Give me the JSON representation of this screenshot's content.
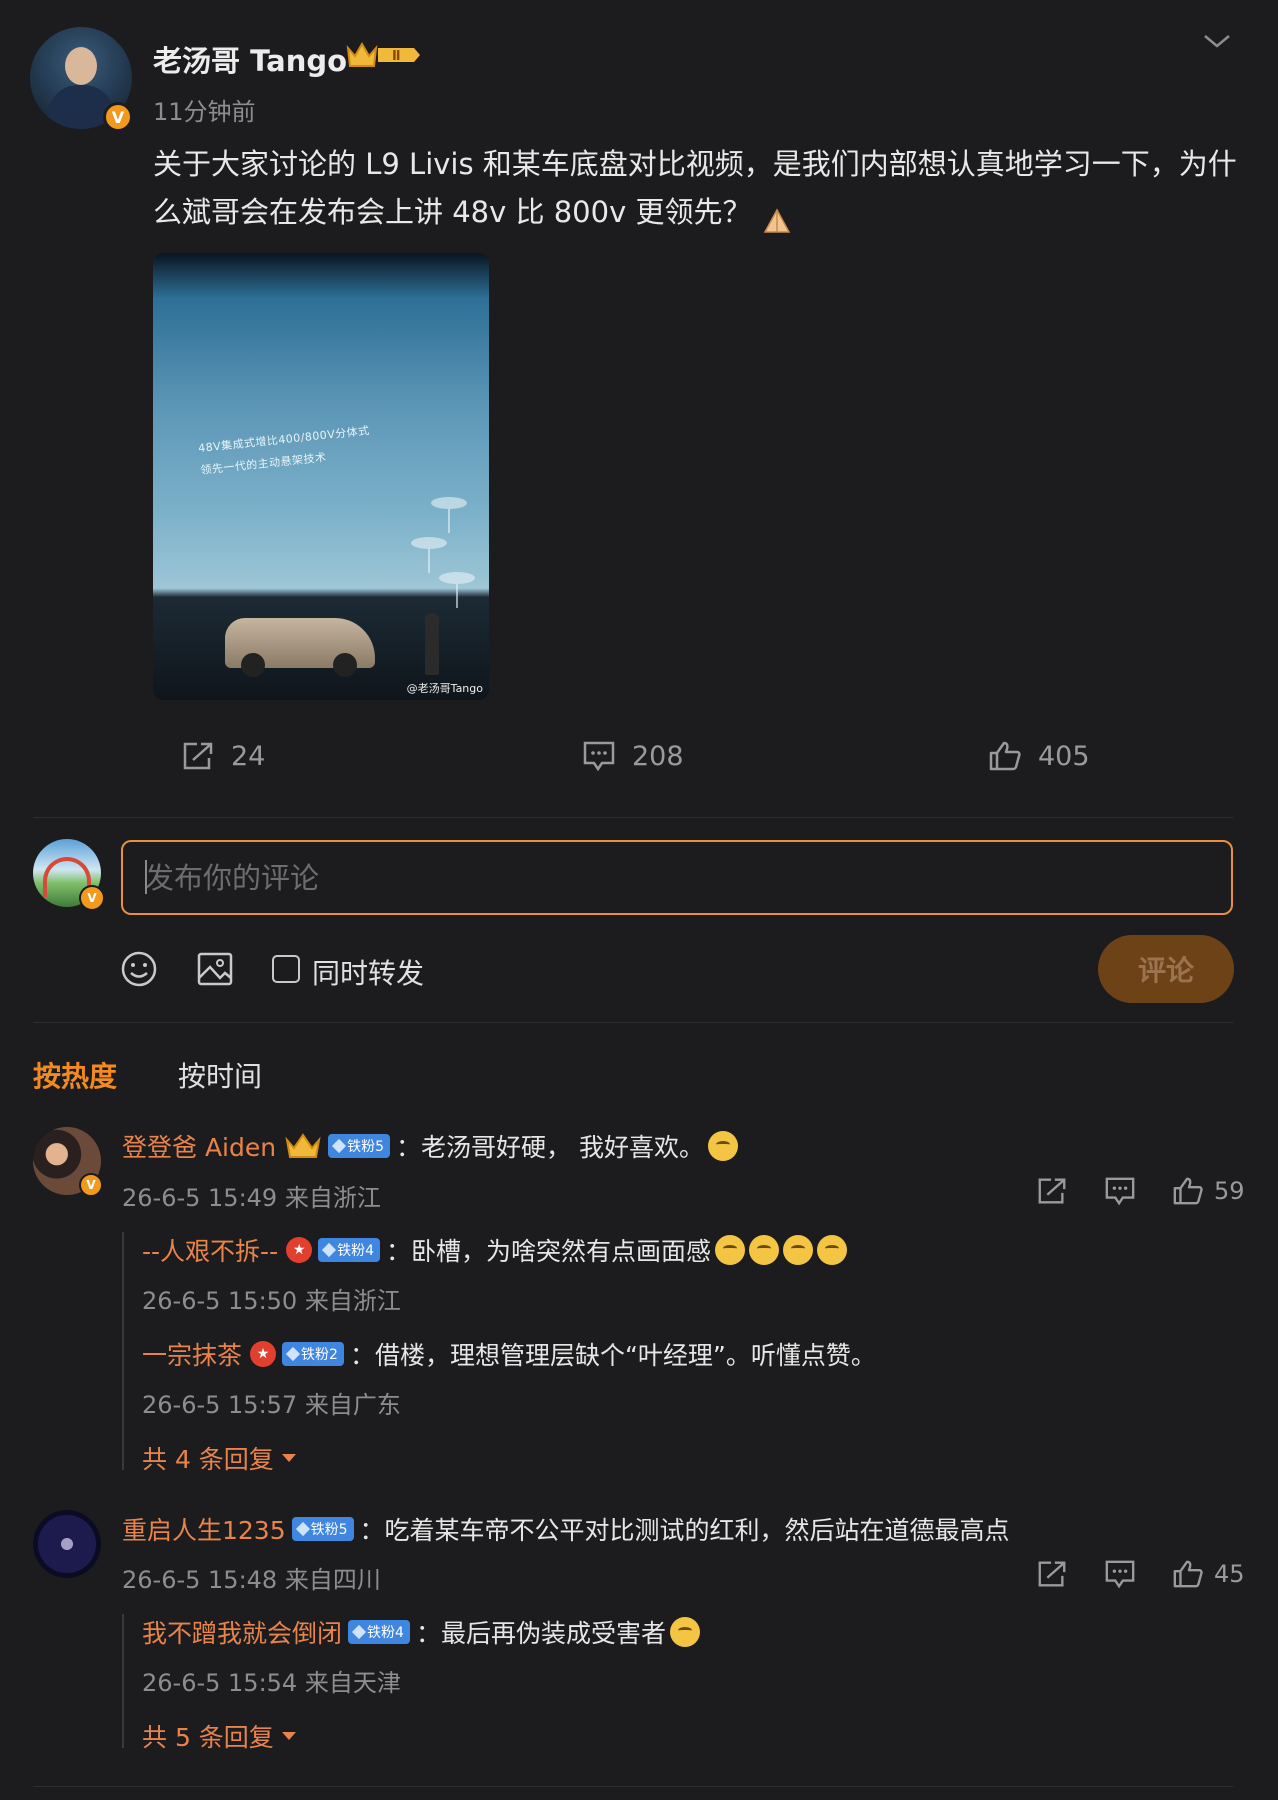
{
  "post": {
    "author": "老汤哥 Tango",
    "level_badge": "Ⅱ",
    "verified_badge": "V",
    "time": "11分钟前",
    "text": "关于大家讨论的 L9 Livis 和某车底盘对比视频，是我们内部想认真地学习一下，为什么斌哥会在发布会上讲 48v 比 800v 更领先？",
    "image": {
      "slogan_line1": "48V集成式增比400/800V分体式",
      "slogan_line2": "领先一代的主动悬架技术",
      "watermark": "@老汤哥Tango"
    },
    "actions": {
      "repost_count": "24",
      "comment_count": "208",
      "like_count": "405"
    }
  },
  "composer": {
    "placeholder": "发布你的评论",
    "value": "",
    "repost_label": "同时转发",
    "submit_label": "评论",
    "verified_badge": "V"
  },
  "sort": {
    "hot": "按热度",
    "time": "按时间"
  },
  "comments": [
    {
      "user": "登登爸 Aiden",
      "fan_badge": "铁粉5",
      "text": "：老汤哥好硬， 我好喜欢。",
      "meta": "26-6-5 15:49 来自浙江",
      "likes": "59",
      "verified_badge": "V",
      "replies": [
        {
          "user": "--人艰不拆--",
          "fan_badge": "铁粉4",
          "text": "：卧槽，为啥突然有点画面感",
          "meta": "26-6-5 15:50 来自浙江"
        },
        {
          "user": "一宗抹茶",
          "fan_badge": "铁粉2",
          "text": "：借楼，理想管理层缺个“叶经理”。听懂点赞。",
          "meta": "26-6-5 15:57 来自广东"
        }
      ],
      "more_replies": "共 4 条回复"
    },
    {
      "user": "重启人生1235",
      "fan_badge": "铁粉5",
      "text": "：吃着某车帝不公平对比测试的红利，然后站在道德最高点",
      "meta": "26-6-5 15:48 来自四川",
      "likes": "45",
      "replies": [
        {
          "user": "我不蹭我就会倒闭",
          "fan_badge": "铁粉4",
          "text": "：最后再伪装成受害者",
          "meta": "26-6-5 15:54 来自天津"
        }
      ],
      "more_replies": "共 5 条回复"
    }
  ],
  "colors": {
    "accent": "#f28a22",
    "username": "#e8844a",
    "background": "#1c1c1e",
    "fan_badge": "#3f86e0"
  }
}
